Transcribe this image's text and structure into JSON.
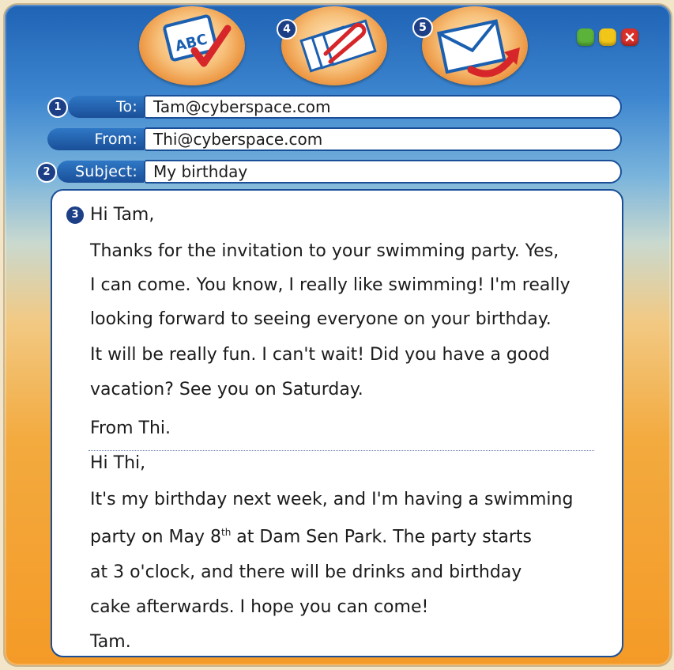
{
  "toolbar": {
    "spellcheck_icon_text": "ABC",
    "attach_number": "4",
    "send_number": "5"
  },
  "window_controls": {
    "colors": [
      "#5bb33a",
      "#f2c618",
      "#d9302a"
    ]
  },
  "header": {
    "to": {
      "number": "1",
      "label": "To:",
      "value": "Tam@cyberspace.com"
    },
    "from": {
      "label": "From:",
      "value": "Thi@cyberspace.com"
    },
    "subject": {
      "number": "2",
      "label": "Subject:",
      "value": "My birthday"
    }
  },
  "message": {
    "number": "3",
    "reply": [
      "Hi Tam,",
      "Thanks for the invitation to your swimming party. Yes,",
      "I can come. You know, I really like swimming! I'm really",
      "looking forward to seeing everyone on your birthday.",
      "It will be really fun. I can't wait! Did you have a good",
      "vacation? See you on Saturday.",
      "From Thi."
    ],
    "original": {
      "line1": "Hi Thi,",
      "line2": "It's my birthday next week, and I'm having a swimming",
      "line3_before": "party on May 8",
      "line3_sup": "th",
      "line3_after": " at Dam Sen Park. The party starts",
      "line4": "at 3 o'clock, and there will be drinks and birthday",
      "line5": "cake afterwards. I hope you can come!",
      "line6": "Tam."
    }
  }
}
